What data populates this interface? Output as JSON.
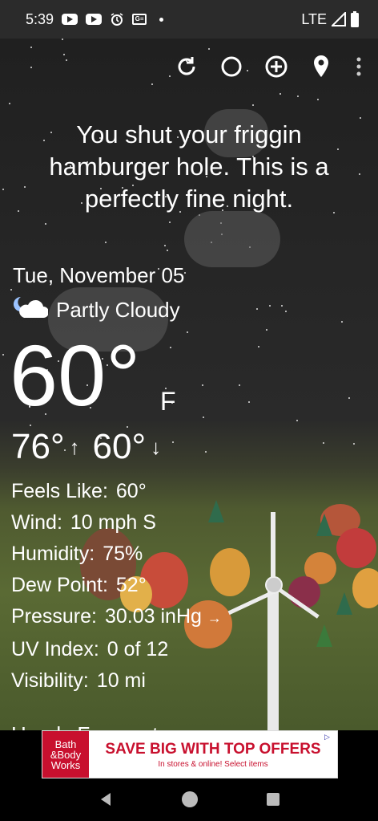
{
  "status_bar": {
    "time": "5:39",
    "network": "LTE",
    "icons": [
      "youtube-icon",
      "youtube-icon",
      "alarm-icon",
      "news-icon",
      "dot-icon",
      "signal-icon",
      "battery-icon"
    ]
  },
  "toolbar": {
    "icons": [
      "refresh-icon",
      "theme-icon",
      "add-location-icon",
      "location-pin-icon",
      "more-vert-icon"
    ]
  },
  "quote": "You shut your friggin hamburger hole. This is a perfectly fine night.",
  "weather": {
    "date": "Tue, November 05",
    "condition": "Partly Cloudy",
    "condition_icon": "partly-cloudy-night-icon",
    "temperature": "60°",
    "unit": "F",
    "high": "76°",
    "low": "60°",
    "high_arrow": "↑",
    "low_arrow": "↓"
  },
  "details": [
    {
      "label": "Feels Like:",
      "value": "60°"
    },
    {
      "label": "Wind:",
      "value": "10 mph S"
    },
    {
      "label": "Humidity:",
      "value": "75%"
    },
    {
      "label": "Dew Point:",
      "value": "52°"
    },
    {
      "label": "Pressure:",
      "value": "30.03 inHg",
      "trend": "→"
    },
    {
      "label": "UV Index:",
      "value": "0 of 12"
    },
    {
      "label": "Visibility:",
      "value": "10 mi"
    }
  ],
  "hourly_heading": "Hourly Forecast",
  "ad": {
    "logo": "Bath &Body Works",
    "headline": "SAVE BIG WITH TOP OFFERS",
    "subtext": "In stores & online! Select items"
  },
  "nav_bar": {
    "icons": [
      "back-icon",
      "home-icon",
      "recents-icon"
    ]
  }
}
